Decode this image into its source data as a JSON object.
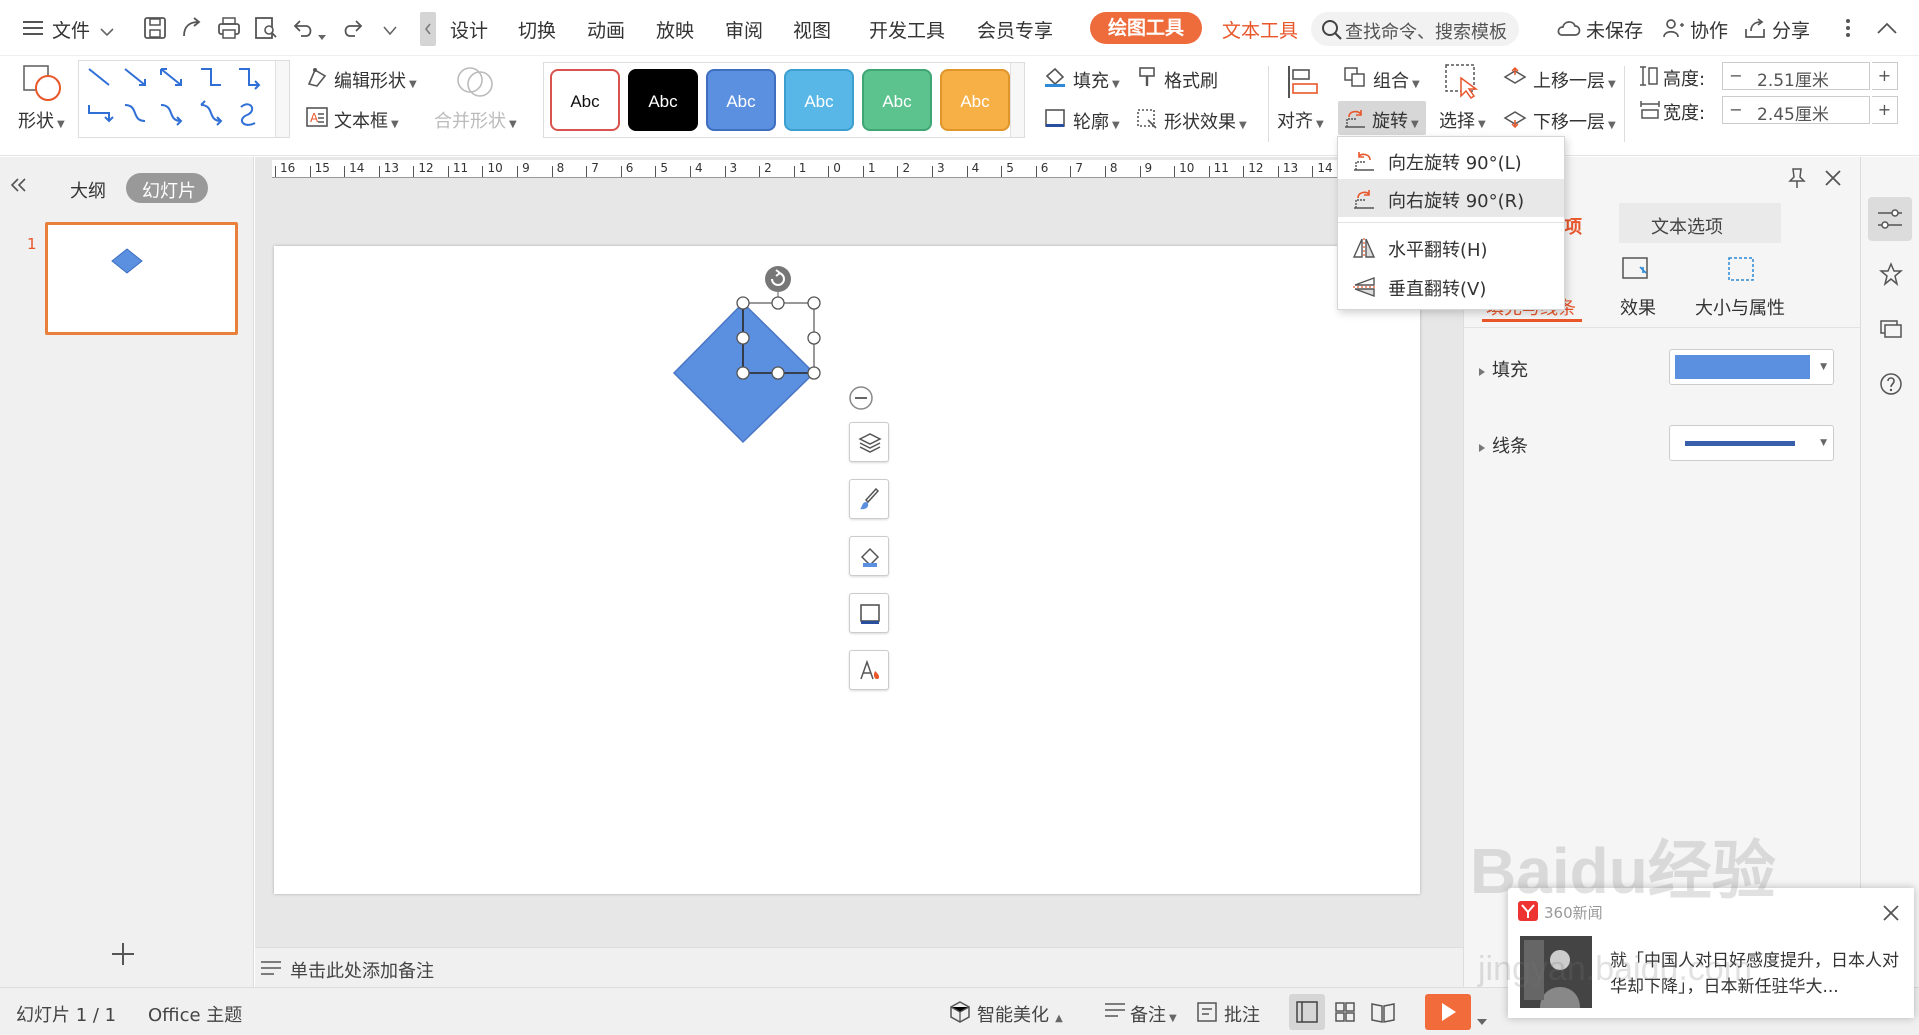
{
  "menubar": {
    "file": "文件",
    "tabs": [
      "设计",
      "切换",
      "动画",
      "放映",
      "审阅",
      "视图",
      "开发工具",
      "会员专享"
    ],
    "drawing_tools": "绘图工具",
    "text_tools": "文本工具",
    "search_placeholder": "查找命令、搜索模板",
    "unsaved": "未保存",
    "collaborate": "协作",
    "share": "分享"
  },
  "ribbon": {
    "shape": "形状",
    "edit_shape": "编辑形状",
    "textbox": "文本框",
    "merge_shape": "合并形状",
    "style_boxes": [
      {
        "label": "Abc",
        "bg": "#ffffff",
        "fg": "#111111",
        "border": "#d9534f"
      },
      {
        "label": "Abc",
        "bg": "#000000",
        "fg": "#ffffff",
        "border": "#000000"
      },
      {
        "label": "Abc",
        "bg": "#5b8fdf",
        "fg": "#ffffff",
        "border": "#3f6fbf"
      },
      {
        "label": "Abc",
        "bg": "#58b7e6",
        "fg": "#ffffff",
        "border": "#3c9fd0"
      },
      {
        "label": "Abc",
        "bg": "#5cc28e",
        "fg": "#ffffff",
        "border": "#3fa673"
      },
      {
        "label": "Abc",
        "bg": "#f6b046",
        "fg": "#ffffff",
        "border": "#e0952a"
      }
    ],
    "fill": "填充",
    "format_painter": "格式刷",
    "outline": "轮廓",
    "shape_effect": "形状效果",
    "align": "对齐",
    "group": "组合",
    "rotate": "旋转",
    "select": "选择",
    "bring_forward": "上移一层",
    "send_backward": "下移一层",
    "height_label": "高度:",
    "height_value": "2.51厘米",
    "width_label": "宽度:",
    "width_value": "2.45厘米"
  },
  "rotate_menu": {
    "items": [
      "向左旋转 90°(L)",
      "向右旋转 90°(R)",
      "水平翻转(H)",
      "垂直翻转(V)"
    ]
  },
  "left_panel": {
    "outline_tab": "大纲",
    "slides_tab": "幻灯片",
    "slide_number": "1"
  },
  "ruler": {
    "labels": [
      "16",
      "15",
      "14",
      "13",
      "12",
      "11",
      "10",
      "9",
      "8",
      "7",
      "6",
      "5",
      "4",
      "3",
      "2",
      "1",
      "0",
      "1",
      "2",
      "3",
      "4",
      "5",
      "6",
      "7",
      "8",
      "9",
      "10",
      "11",
      "12",
      "13",
      "14"
    ]
  },
  "notes": {
    "placeholder": "单击此处添加备注"
  },
  "right_panel": {
    "tab_shape_options": "项",
    "tab_text_options": "文本选项",
    "sub_fill_line": "填充与线条",
    "sub_effect": "效果",
    "sub_size": "大小与属性",
    "fill_label": "填充",
    "line_label": "线条",
    "fill_color": "#5b8fdf",
    "line_color": "#3a5faa"
  },
  "statusbar": {
    "slide_info": "幻灯片 1 / 1",
    "theme": "Office 主题",
    "smart_beautify": "智能美化",
    "notes": "备注",
    "comments": "批注"
  },
  "news": {
    "source": "360新闻",
    "headline": "就「中国人对日好感度提升，日本人对华却下降」，日本新任驻华大..."
  },
  "watermark": {
    "text": "Baidu经验",
    "url": "jingyan.baidu.com"
  },
  "colors": {
    "accent": "#ee6b3b",
    "shape_fill": "#5b8fdf",
    "play": "#f26b3a"
  }
}
